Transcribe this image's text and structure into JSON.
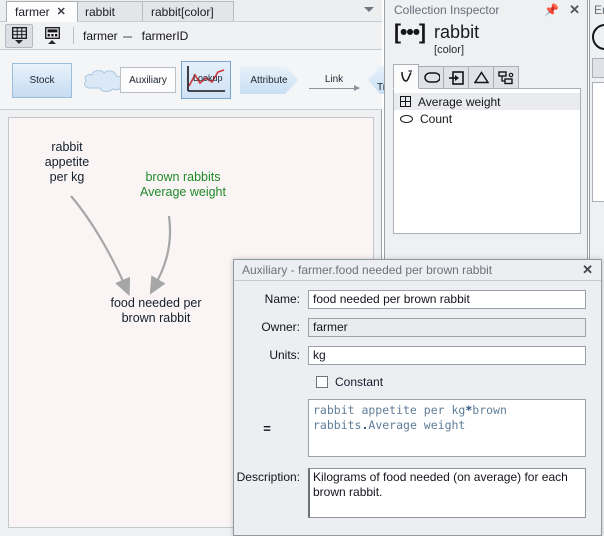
{
  "tabs": [
    {
      "label": "farmer",
      "close": "✕",
      "active": true
    },
    {
      "label": "rabbit",
      "active": false
    },
    {
      "label": "rabbit[color]",
      "active": false
    }
  ],
  "toolbar": {
    "grid_icon": "table-grid-icon",
    "calc_icon": "calculator-icon",
    "breadcrumb_root": "farmer",
    "breadcrumb_sep": "---",
    "breadcrumb_leaf": "farmerID",
    "dropdown_icon": "chevron-down-icon"
  },
  "palette": {
    "items": [
      {
        "label": "Stock",
        "name": "stock"
      },
      {
        "label": "",
        "name": "cloud"
      },
      {
        "label": "Auxiliary",
        "name": "auxiliary"
      },
      {
        "label": "Lookup",
        "name": "lookup"
      },
      {
        "label": "Attribute",
        "name": "attribute"
      },
      {
        "label": "Link",
        "name": "link"
      },
      {
        "label": "Tri",
        "name": "trigger"
      }
    ]
  },
  "canvas": {
    "nodes": [
      {
        "label": "rabbit\nappetite\nper kg",
        "color": "#15202e"
      },
      {
        "label": "brown rabbits\nAverage weight",
        "color": "#1f8a2a"
      },
      {
        "label": "food needed per\nbrown rabbit",
        "color": "#15202e"
      }
    ],
    "arrow_color": "#a6a6a6",
    "background": "#faf5f4"
  },
  "inspector": {
    "title": "Collection Inspector",
    "pin_icon": "pin-icon",
    "close_icon": "close-icon",
    "glyph": "[•••]",
    "name": "rabbit",
    "subtitle": "[color]",
    "tabs": [
      {
        "icon": "variables-v-icon",
        "active": true
      },
      {
        "icon": "oval-shape-icon",
        "active": false
      },
      {
        "icon": "input-arrow-icon",
        "active": false
      },
      {
        "icon": "triangle-icon",
        "active": false
      },
      {
        "icon": "hierarchy-tree-icon",
        "active": false
      }
    ],
    "rows": [
      {
        "label": "Average weight",
        "icon": "grid-icon",
        "selected": true
      },
      {
        "label": "Count",
        "icon": "oval-icon",
        "selected": false
      }
    ]
  },
  "far_panel": {
    "title": "En"
  },
  "dialog": {
    "title": "Auxiliary - farmer.food needed per brown rabbit",
    "close_icon": "close-icon",
    "name_label": "Name:",
    "name_value": "food needed per brown rabbit",
    "owner_label": "Owner:",
    "owner_value": "farmer",
    "units_label": "Units:",
    "units_value": "kg",
    "constant_label": "Constant",
    "constant_checked": false,
    "equals_label": "=",
    "formula_part1": "rabbit appetite per kg",
    "formula_op1": "*",
    "formula_part2": "brown rabbits",
    "formula_op2": ".",
    "formula_part3": "Average weight",
    "description_label": "Description:",
    "description_value": "Kilograms of food needed (on average) for each brown rabbit."
  }
}
